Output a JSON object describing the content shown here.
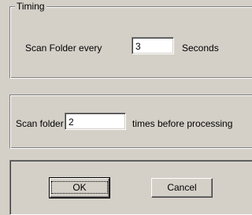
{
  "timing": {
    "title": "Timing",
    "scan_label": "Scan Folder every",
    "scan_value": "3",
    "unit_label": "Seconds"
  },
  "scan_count": {
    "label": "Scan folder",
    "value": "2",
    "suffix": "times before processing"
  },
  "buttons": {
    "ok": "OK",
    "cancel": "Cancel"
  }
}
